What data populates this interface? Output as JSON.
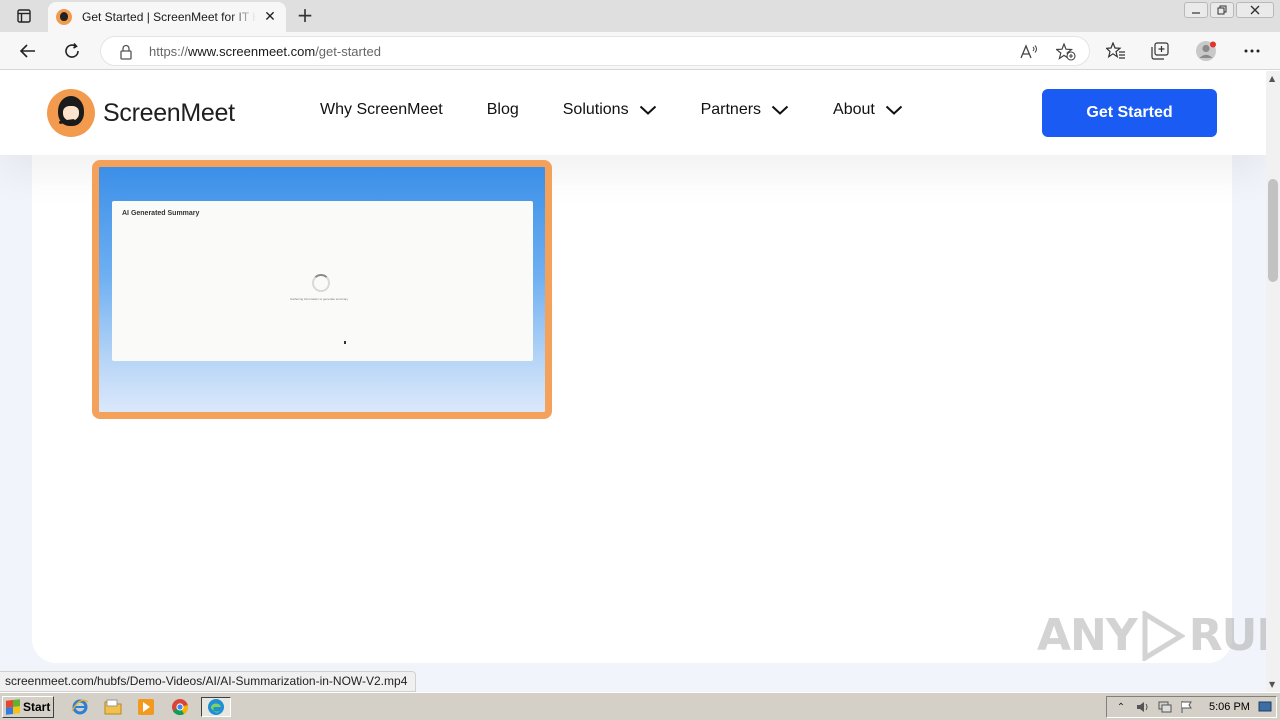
{
  "browser": {
    "tab_title": "Get Started | ScreenMeet for IT Help Desk",
    "tab_close": "✕",
    "new_tab": "+",
    "url_prefix": "https://",
    "url_domain": "www.screenmeet.com",
    "url_path": "/get-started",
    "status_url": "screenmeet.com/hubfs/Demo-Videos/AI/AI-Summarization-in-NOW-V2.mp4"
  },
  "site": {
    "logo_text": "ScreenMeet",
    "nav": [
      {
        "label": "Why ScreenMeet",
        "has_dropdown": false
      },
      {
        "label": "Blog",
        "has_dropdown": false
      },
      {
        "label": "Solutions",
        "has_dropdown": true
      },
      {
        "label": "Partners",
        "has_dropdown": true
      },
      {
        "label": "About",
        "has_dropdown": true
      }
    ],
    "cta_label": "Get Started",
    "brand_orange": "#f3a15b",
    "brand_blue": "#1a5cf3"
  },
  "video": {
    "panel_title": "AI Generated Summary",
    "status_text": "Gathering information to generate summary"
  },
  "watermark": {
    "left": "ANY",
    "right": "RUN"
  },
  "taskbar": {
    "start_label": "Start",
    "clock": "5:06 PM"
  }
}
